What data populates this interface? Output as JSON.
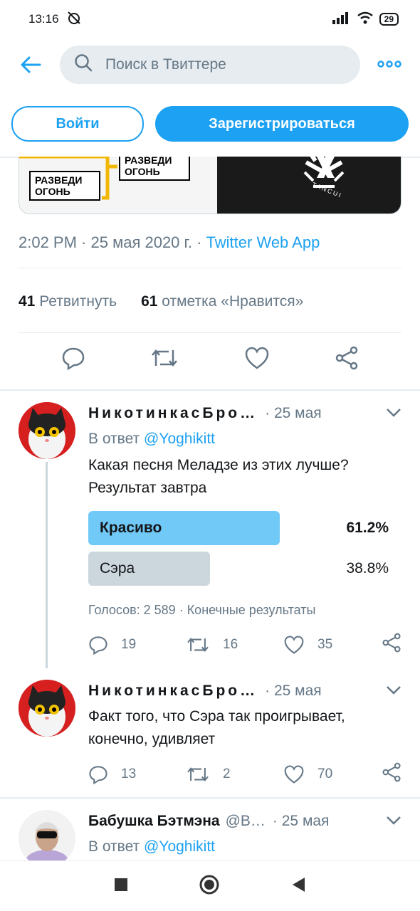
{
  "status": {
    "time": "13:16",
    "battery": "29"
  },
  "search": {
    "placeholder": "Поиск в Твиттере"
  },
  "auth": {
    "login": "Войти",
    "register": "Зарегистрироваться"
  },
  "media": {
    "sign1": "РАЗВЕДИ ОГОНЬ",
    "sign2": "РАЗВЕДИ ОГОНЬ",
    "logo": "TANCUI"
  },
  "main_tweet": {
    "time": "2:02 PM",
    "date": "25 мая 2020 г.",
    "app": "Twitter Web App",
    "retweets_count": "41",
    "retweets_label": "Ретвитнуть",
    "likes_count": "61",
    "likes_label": "отметка «Нравится»"
  },
  "replies": [
    {
      "name": "НикотинкасБро…",
      "time": "25 мая",
      "reply_prefix": "В ответ",
      "reply_to": "@Yoghikitt",
      "text": "Какая песня Меладзе из этих лучше? Результат завтра",
      "poll": {
        "options": [
          {
            "label": "Красиво",
            "percent": "61.2%",
            "value": 61.2,
            "winner": true
          },
          {
            "label": "Сэра",
            "percent": "38.8%",
            "value": 38.8,
            "winner": false
          }
        ],
        "summary": "Голосов: 2 589 · Конечные результаты"
      },
      "replies": "19",
      "retweets": "16",
      "likes": "35"
    },
    {
      "name": "НикотинкасБро…",
      "time": "25 мая",
      "text": "Факт того, что Сэра так проигрывает, конечно, удивляет",
      "replies": "13",
      "retweets": "2",
      "likes": "70"
    },
    {
      "name": "Бабушка Бэтмэна",
      "handle": "@B…",
      "time": "25 мая",
      "reply_prefix": "В ответ",
      "reply_to": "@Yoghikitt"
    }
  ],
  "colors": {
    "accent": "#1da1f2",
    "secondary": "#657786",
    "poll_winner": "#71c9f8",
    "poll_other": "#ccd6dd"
  }
}
